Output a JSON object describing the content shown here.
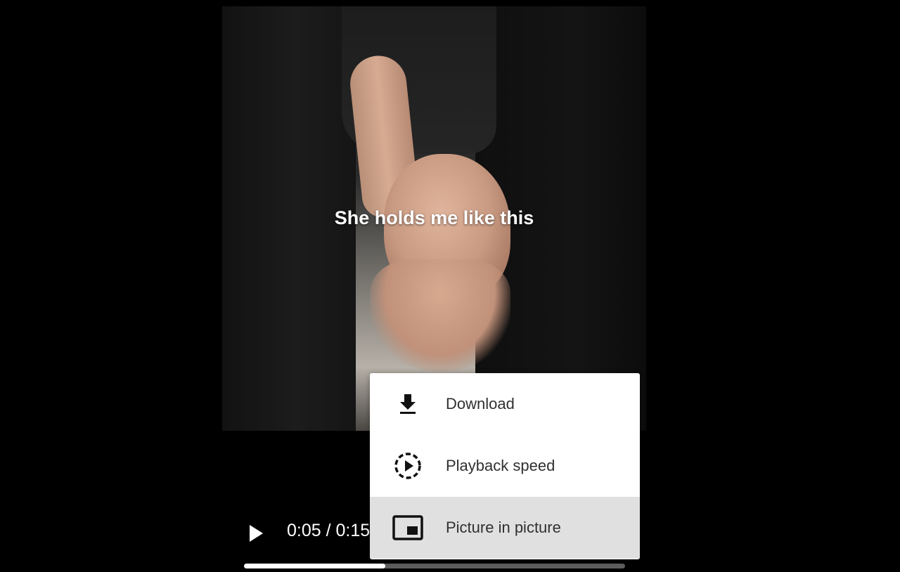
{
  "video": {
    "caption": "She holds me like this",
    "time_display": "0:05 / 0:15",
    "current_time": "0:05",
    "duration": "0:15",
    "progress_fraction": 0.37
  },
  "menu": {
    "items": [
      {
        "label": "Download",
        "icon": "download-icon",
        "highlighted": false
      },
      {
        "label": "Playback speed",
        "icon": "playback-speed-icon",
        "highlighted": false
      },
      {
        "label": "Picture in picture",
        "icon": "picture-in-picture-icon",
        "highlighted": true
      }
    ]
  },
  "colors": {
    "background": "#000000",
    "menu_bg": "#ffffff",
    "menu_highlight": "#e0e0e0",
    "progress_fill": "#ffffff",
    "progress_track": "#5e5e5e"
  }
}
